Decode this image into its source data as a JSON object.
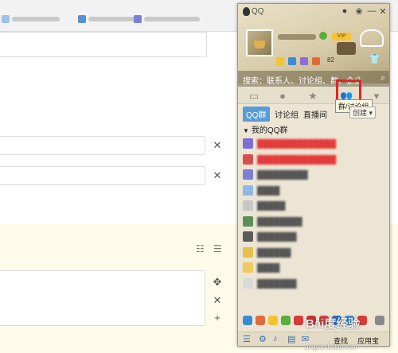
{
  "qq": {
    "app_name": "QQ",
    "search_placeholder": "搜索：联系人、讨论组、群、企业",
    "unread_count": "82",
    "tooltip": "群/讨论组",
    "sub_tabs": [
      "QQ群",
      "讨论组",
      "直播间"
    ],
    "create_label": "创建",
    "group_header": "我的QQ群",
    "groups": [
      {
        "name": "██████████████",
        "color": "#7e6fd6",
        "red": true
      },
      {
        "name": "██████████████",
        "color": "#d65050",
        "red": true
      },
      {
        "name": "█████████",
        "color": "#7b7fd6",
        "red": false
      },
      {
        "name": "████",
        "color": "#8fb8e6",
        "red": false
      },
      {
        "name": "█████",
        "color": "#c7c7c7",
        "red": false
      },
      {
        "name": "████████",
        "color": "#5a8f5a",
        "red": false
      },
      {
        "name": "███████",
        "color": "#5b5b5b",
        "red": false
      },
      {
        "name": "██████",
        "color": "#e2c24a",
        "red": false
      },
      {
        "name": "████",
        "color": "#f0c860",
        "red": false
      },
      {
        "name": "███████",
        "color": "#d9d9d9",
        "red": false
      }
    ],
    "bottom_bar": {
      "find_label": "查找",
      "app_label": "应用宝"
    }
  },
  "watermark": {
    "brand": "Bai度经验",
    "url": "jingyan.baidu.com"
  }
}
